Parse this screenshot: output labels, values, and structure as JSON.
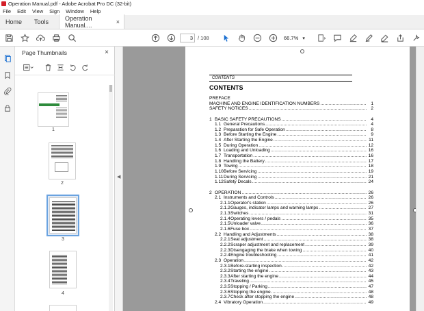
{
  "window": {
    "title": "Operation Manual.pdf - Adobe Acrobat Pro DC (32-bit)"
  },
  "menu": [
    "File",
    "Edit",
    "View",
    "Sign",
    "Window",
    "Help"
  ],
  "tabs": {
    "home": "Home",
    "tools": "Tools",
    "document": "Operation Manual....",
    "close": "×"
  },
  "toolbar": {
    "page_current": "3",
    "page_total": "/ 108",
    "zoom": "66.7%",
    "zoom_caret": "▾"
  },
  "thumbnails": {
    "title": "Page Thumbnails",
    "close": "×",
    "pages": [
      {
        "number": "1"
      },
      {
        "number": "2"
      },
      {
        "number": "3",
        "selected": true
      },
      {
        "number": "4"
      }
    ]
  },
  "document": {
    "header": "CONTENTS",
    "title": "CONTENTS",
    "toc": [
      {
        "num": "",
        "text": "PREFACE",
        "page": "",
        "indent": 0,
        "dots": false
      },
      {
        "num": "",
        "text": "MACHINE AND ENGINE IDENTIFICATION NUMBERS",
        "page": "1",
        "indent": 0,
        "dots": true
      },
      {
        "num": "",
        "text": "SAFETY NOTICES",
        "page": "2",
        "indent": 0,
        "dots": true
      },
      {
        "gap": true
      },
      {
        "num": "1",
        "text": "BASIC SAFETY PRECAUTIONS",
        "page": "4",
        "indent": 0,
        "dots": true
      },
      {
        "num": "1.1",
        "text": "General Precautions",
        "page": "4",
        "indent": 1,
        "dots": true
      },
      {
        "num": "1.2",
        "text": "Preparation for Safe Operation",
        "page": "8",
        "indent": 1,
        "dots": true
      },
      {
        "num": "1.3",
        "text": "Before Starting the Engine",
        "page": "9",
        "indent": 1,
        "dots": true
      },
      {
        "num": "1.4",
        "text": "After Starting the Engine",
        "page": "11",
        "indent": 1,
        "dots": true
      },
      {
        "num": "1.5",
        "text": "During Operation",
        "page": "12",
        "indent": 1,
        "dots": true
      },
      {
        "num": "1.6",
        "text": "Loading and Unloading",
        "page": "16",
        "indent": 1,
        "dots": true
      },
      {
        "num": "1.7",
        "text": "Transportation",
        "page": "16",
        "indent": 1,
        "dots": true
      },
      {
        "num": "1.8",
        "text": "Handling the Battery",
        "page": "17",
        "indent": 1,
        "dots": true
      },
      {
        "num": "1.9",
        "text": "Towing",
        "page": "18",
        "indent": 1,
        "dots": true
      },
      {
        "num": "1.10",
        "text": "Before Servicing",
        "page": "19",
        "indent": 1,
        "dots": true
      },
      {
        "num": "1.11",
        "text": "During Servicing",
        "page": "21",
        "indent": 1,
        "dots": true
      },
      {
        "num": "1.12",
        "text": "Safety Decals",
        "page": "24",
        "indent": 1,
        "dots": true
      },
      {
        "gap": true
      },
      {
        "num": "2",
        "text": "OPERATION",
        "page": "26",
        "indent": 0,
        "dots": true
      },
      {
        "num": "2.1",
        "text": "Instruments and Controls",
        "page": "26",
        "indent": 1,
        "dots": true
      },
      {
        "num": "2.1.1",
        "text": "Operator's station",
        "page": "26",
        "indent": 2,
        "dots": true
      },
      {
        "num": "2.1.2",
        "text": "Gauges, indicator lamps and warning lamps",
        "page": "27",
        "indent": 2,
        "dots": true
      },
      {
        "num": "2.1.3",
        "text": "Switches",
        "page": "31",
        "indent": 2,
        "dots": true
      },
      {
        "num": "2.1.4",
        "text": "Operating levers / pedals",
        "page": "35",
        "indent": 2,
        "dots": true
      },
      {
        "num": "2.1.5",
        "text": "Unloader valve",
        "page": "36",
        "indent": 2,
        "dots": true
      },
      {
        "num": "2.1.6",
        "text": "Fuse box",
        "page": "37",
        "indent": 2,
        "dots": true
      },
      {
        "num": "2.2",
        "text": "Handling and Adjustments",
        "page": "38",
        "indent": 1,
        "dots": true
      },
      {
        "num": "2.2.1",
        "text": "Seat adjustment",
        "page": "38",
        "indent": 2,
        "dots": true
      },
      {
        "num": "2.2.2",
        "text": "Scraper adjustment and replacement",
        "page": "39",
        "indent": 2,
        "dots": true
      },
      {
        "num": "2.2.3",
        "text": "Disengaging the brake when towing",
        "page": "40",
        "indent": 2,
        "dots": true
      },
      {
        "num": "2.2.4",
        "text": "Engine troubleshooting",
        "page": "41",
        "indent": 2,
        "dots": true
      },
      {
        "num": "2.3",
        "text": "Operation",
        "page": "42",
        "indent": 1,
        "dots": true
      },
      {
        "num": "2.3.1",
        "text": "Before-starting inspection",
        "page": "42",
        "indent": 2,
        "dots": true
      },
      {
        "num": "2.3.2",
        "text": "Starting the engine",
        "page": "43",
        "indent": 2,
        "dots": true
      },
      {
        "num": "2.3.3",
        "text": "After starting the engine",
        "page": "44",
        "indent": 2,
        "dots": true
      },
      {
        "num": "2.3.4",
        "text": "Traveling",
        "page": "45",
        "indent": 2,
        "dots": true
      },
      {
        "num": "2.3.5",
        "text": "Stopping / Parking",
        "page": "47",
        "indent": 2,
        "dots": true
      },
      {
        "num": "2.3.6",
        "text": "Stopping the engine",
        "page": "48",
        "indent": 2,
        "dots": true
      },
      {
        "num": "2.3.7",
        "text": "Check after stopping the engine",
        "page": "48",
        "indent": 2,
        "dots": true
      },
      {
        "num": "2.4",
        "text": "Vibratory Operation",
        "page": "49",
        "indent": 1,
        "dots": true
      }
    ]
  }
}
